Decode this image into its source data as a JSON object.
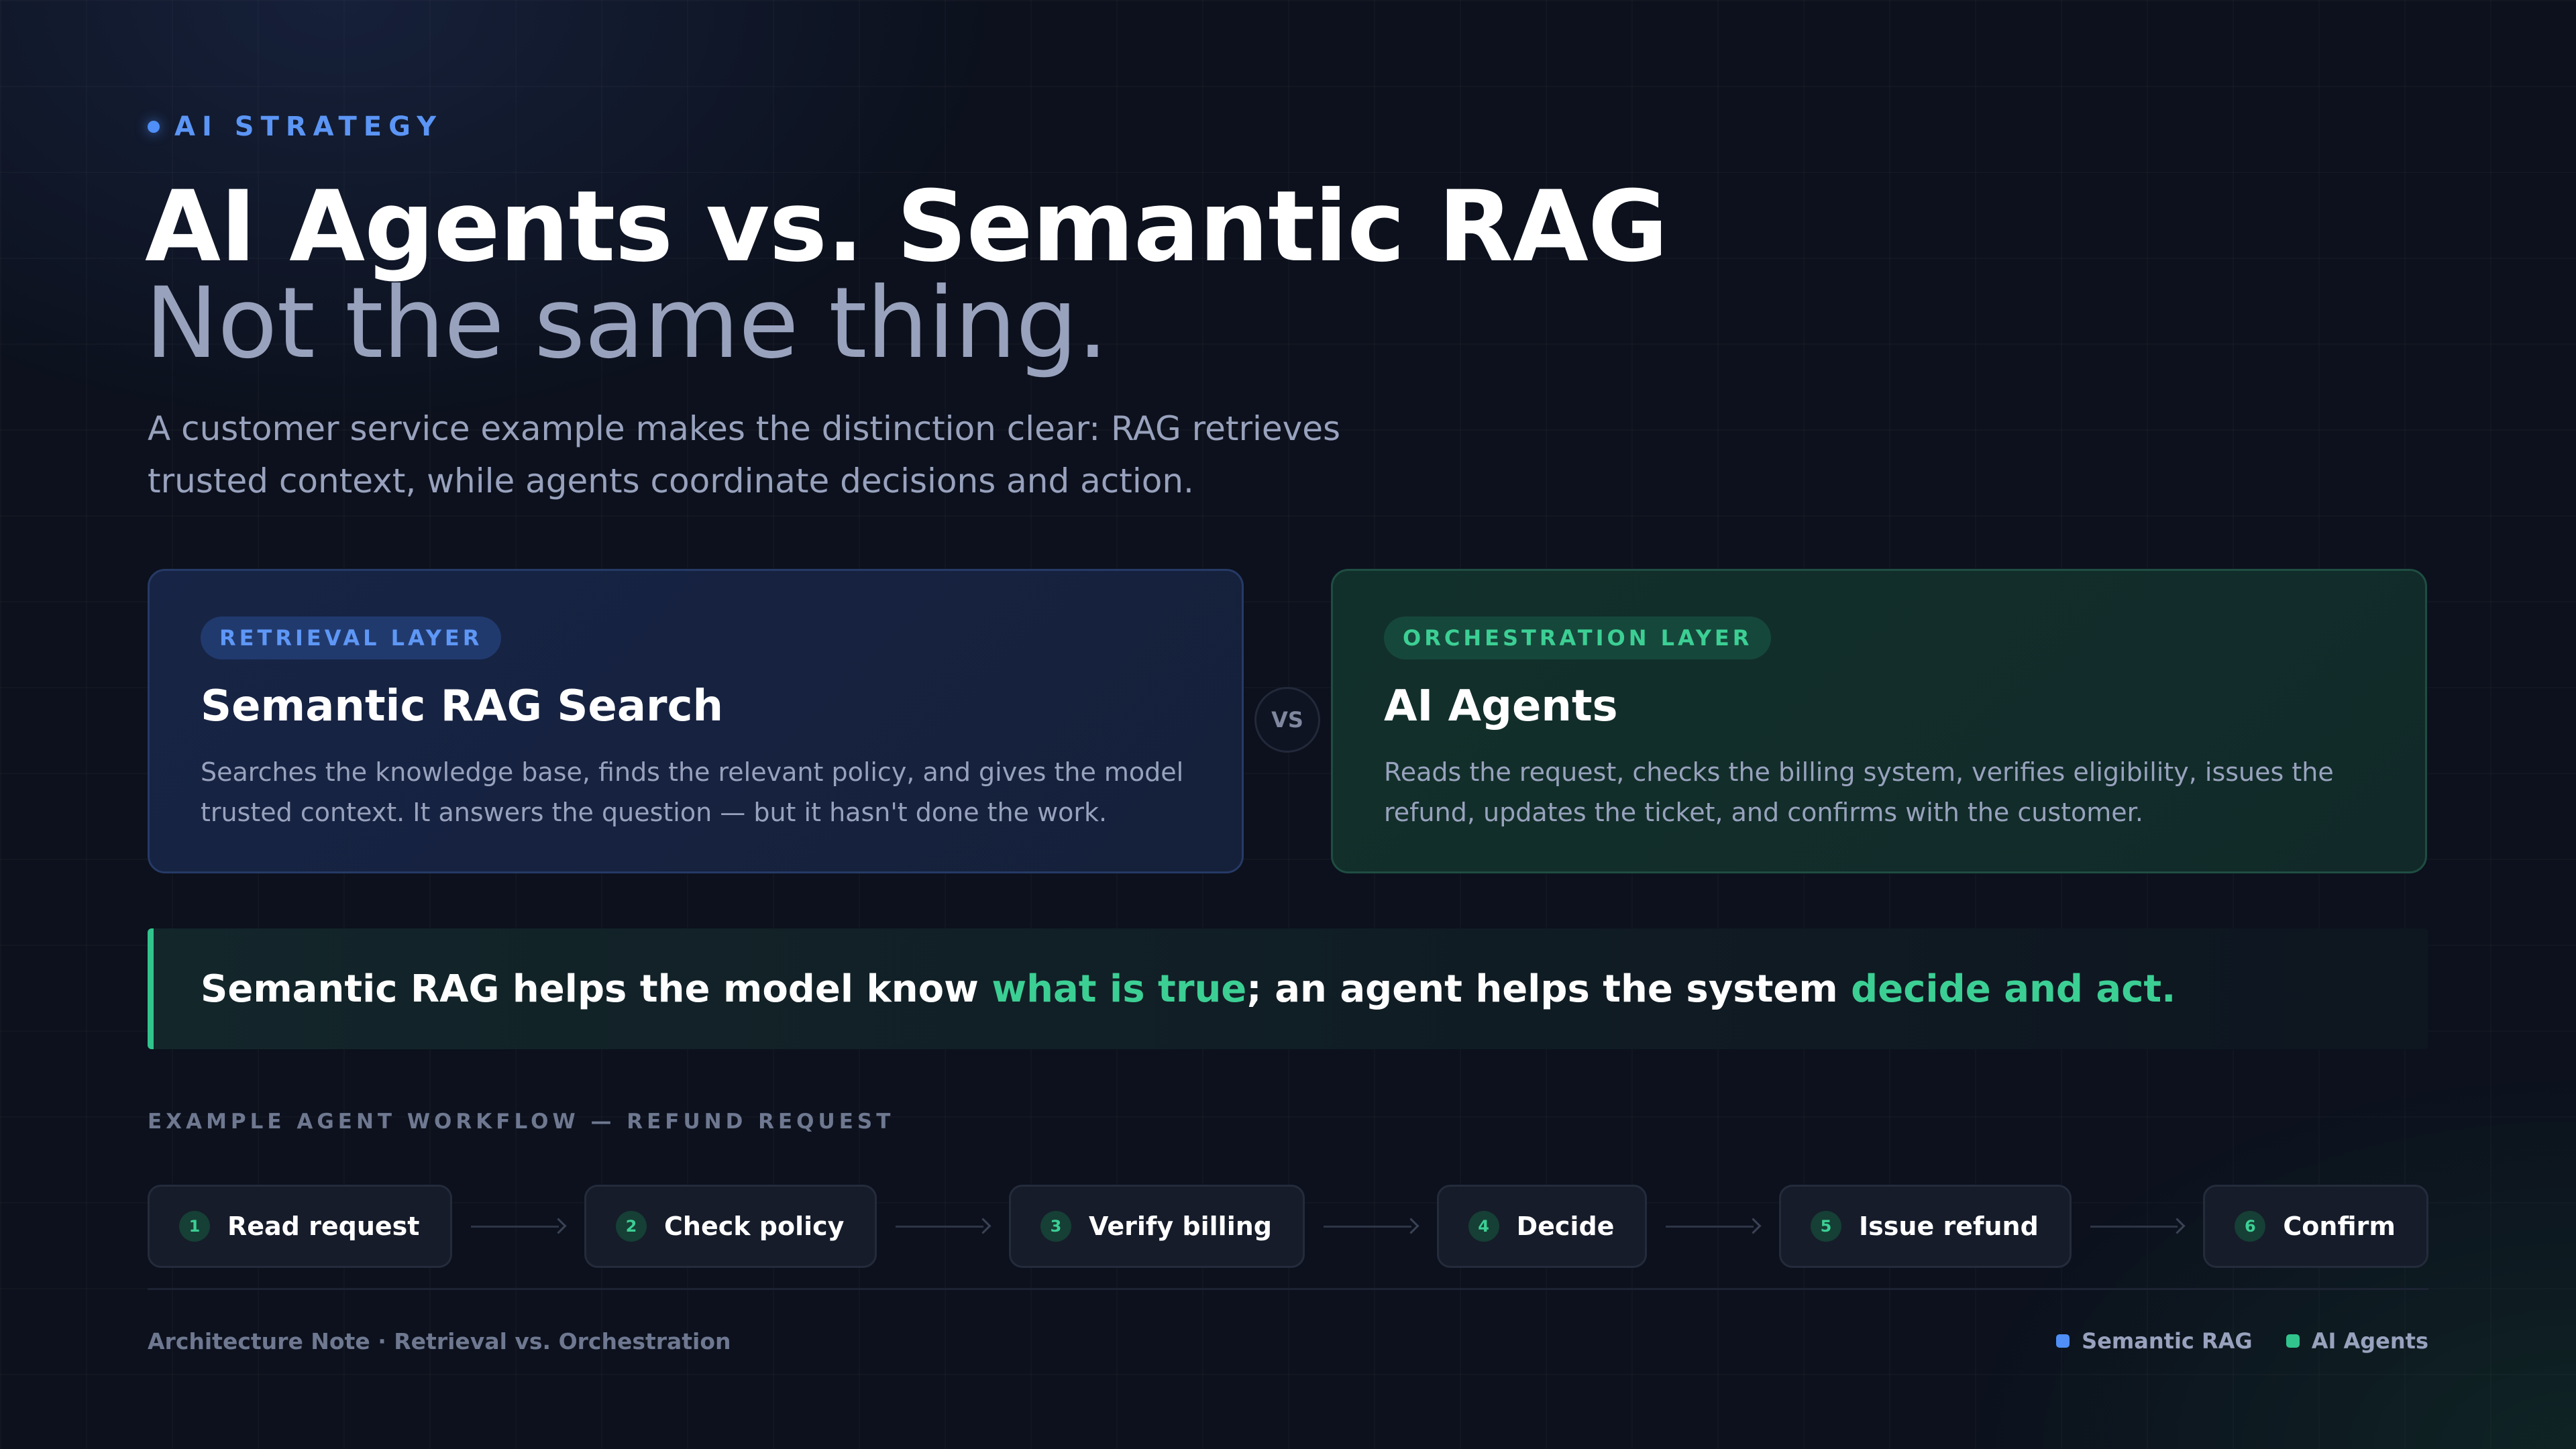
{
  "eyebrow": "AI STRATEGY",
  "title": "AI Agents vs. Semantic RAG",
  "subtitle": "Not the same thing.",
  "intro_line1": "A customer service example makes the distinction clear: RAG retrieves",
  "intro_line2": "trusted context, while agents coordinate decisions and action.",
  "cards": [
    {
      "tag": "RETRIEVAL LAYER",
      "title": "Semantic RAG Search",
      "body": "Searches the knowledge base, finds the relevant policy, and gives the model trusted context. It answers the question — but it hasn't done the work."
    },
    {
      "tag": "ORCHESTRATION LAYER",
      "title": "AI Agents",
      "body": "Reads the request, checks the billing system, verifies eligibility, issues the refund, updates the ticket, and confirms with the customer."
    }
  ],
  "vs_label": "VS",
  "callout": {
    "part1": "Semantic RAG helps the model know ",
    "highlight1": "what is true",
    "part2": "; an agent helps the system ",
    "highlight2": "decide and act."
  },
  "workflow": {
    "label": "EXAMPLE AGENT WORKFLOW — REFUND REQUEST",
    "steps": [
      {
        "num": "1",
        "label": "Read request"
      },
      {
        "num": "2",
        "label": "Check policy"
      },
      {
        "num": "3",
        "label": "Verify billing"
      },
      {
        "num": "4",
        "label": "Decide"
      },
      {
        "num": "5",
        "label": "Issue refund"
      },
      {
        "num": "6",
        "label": "Confirm"
      }
    ]
  },
  "footer": {
    "note": "Architecture Note · Retrieval vs. Orchestration",
    "legend": [
      {
        "label": "Semantic RAG",
        "color": "#4f8ff7"
      },
      {
        "label": "AI Agents",
        "color": "#31c48d"
      }
    ]
  },
  "colors": {
    "background": "#0c111d",
    "rag_accent": "#4f8ff7",
    "agent_accent": "#3ccf94",
    "muted_text": "#98a2bd"
  }
}
